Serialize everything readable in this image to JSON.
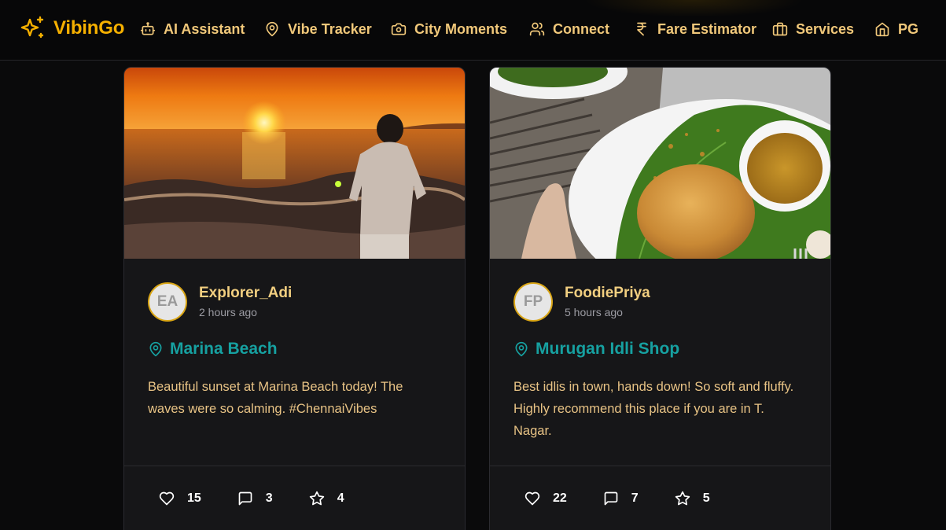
{
  "brand": {
    "name": "VibinGo",
    "color": "#f5b000"
  },
  "nav": {
    "items": [
      {
        "label": "AI Assistant",
        "icon": "robot-icon"
      },
      {
        "label": "Vibe Tracker",
        "icon": "map-pin-icon"
      },
      {
        "label": "City Moments",
        "icon": "camera-icon"
      },
      {
        "label": "Connect",
        "icon": "users-icon"
      },
      {
        "label": "Fare Estimator",
        "icon": "rupee-icon"
      },
      {
        "label": "Services",
        "icon": "briefcase-icon"
      },
      {
        "label": "PG",
        "icon": "home-icon"
      }
    ]
  },
  "posts": [
    {
      "initials": "EA",
      "username": "Explorer_Adi",
      "time": "2 hours ago",
      "location": "Marina Beach",
      "text": "Beautiful sunset at Marina Beach today! The waves were so calming. #ChennaiVibes",
      "likes": "15",
      "comments": "3",
      "stars": "4",
      "image": "sunset-beach-photo"
    },
    {
      "initials": "FP",
      "username": "FoodiePriya",
      "time": "5 hours ago",
      "location": "Murugan Idli Shop",
      "text": "Best idlis in town, hands down! So soft and fluffy. Highly recommend this place if you are in T. Nagar.",
      "likes": "22",
      "comments": "7",
      "stars": "5",
      "image": "idli-plate-photo"
    }
  ],
  "colors": {
    "accent": "#f5b000",
    "nav_text": "#f1c87a",
    "location": "#16a1a1",
    "post_text": "#e8c385",
    "card_bg": "#161618"
  }
}
